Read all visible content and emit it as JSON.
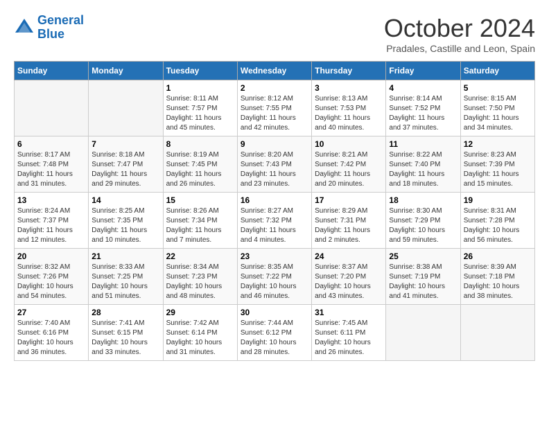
{
  "header": {
    "logo_line1": "General",
    "logo_line2": "Blue",
    "month_title": "October 2024",
    "location": "Pradales, Castille and Leon, Spain"
  },
  "weekdays": [
    "Sunday",
    "Monday",
    "Tuesday",
    "Wednesday",
    "Thursday",
    "Friday",
    "Saturday"
  ],
  "weeks": [
    [
      {
        "day": "",
        "info": ""
      },
      {
        "day": "",
        "info": ""
      },
      {
        "day": "1",
        "info": "Sunrise: 8:11 AM\nSunset: 7:57 PM\nDaylight: 11 hours and 45 minutes."
      },
      {
        "day": "2",
        "info": "Sunrise: 8:12 AM\nSunset: 7:55 PM\nDaylight: 11 hours and 42 minutes."
      },
      {
        "day": "3",
        "info": "Sunrise: 8:13 AM\nSunset: 7:53 PM\nDaylight: 11 hours and 40 minutes."
      },
      {
        "day": "4",
        "info": "Sunrise: 8:14 AM\nSunset: 7:52 PM\nDaylight: 11 hours and 37 minutes."
      },
      {
        "day": "5",
        "info": "Sunrise: 8:15 AM\nSunset: 7:50 PM\nDaylight: 11 hours and 34 minutes."
      }
    ],
    [
      {
        "day": "6",
        "info": "Sunrise: 8:17 AM\nSunset: 7:48 PM\nDaylight: 11 hours and 31 minutes."
      },
      {
        "day": "7",
        "info": "Sunrise: 8:18 AM\nSunset: 7:47 PM\nDaylight: 11 hours and 29 minutes."
      },
      {
        "day": "8",
        "info": "Sunrise: 8:19 AM\nSunset: 7:45 PM\nDaylight: 11 hours and 26 minutes."
      },
      {
        "day": "9",
        "info": "Sunrise: 8:20 AM\nSunset: 7:43 PM\nDaylight: 11 hours and 23 minutes."
      },
      {
        "day": "10",
        "info": "Sunrise: 8:21 AM\nSunset: 7:42 PM\nDaylight: 11 hours and 20 minutes."
      },
      {
        "day": "11",
        "info": "Sunrise: 8:22 AM\nSunset: 7:40 PM\nDaylight: 11 hours and 18 minutes."
      },
      {
        "day": "12",
        "info": "Sunrise: 8:23 AM\nSunset: 7:39 PM\nDaylight: 11 hours and 15 minutes."
      }
    ],
    [
      {
        "day": "13",
        "info": "Sunrise: 8:24 AM\nSunset: 7:37 PM\nDaylight: 11 hours and 12 minutes."
      },
      {
        "day": "14",
        "info": "Sunrise: 8:25 AM\nSunset: 7:35 PM\nDaylight: 11 hours and 10 minutes."
      },
      {
        "day": "15",
        "info": "Sunrise: 8:26 AM\nSunset: 7:34 PM\nDaylight: 11 hours and 7 minutes."
      },
      {
        "day": "16",
        "info": "Sunrise: 8:27 AM\nSunset: 7:32 PM\nDaylight: 11 hours and 4 minutes."
      },
      {
        "day": "17",
        "info": "Sunrise: 8:29 AM\nSunset: 7:31 PM\nDaylight: 11 hours and 2 minutes."
      },
      {
        "day": "18",
        "info": "Sunrise: 8:30 AM\nSunset: 7:29 PM\nDaylight: 10 hours and 59 minutes."
      },
      {
        "day": "19",
        "info": "Sunrise: 8:31 AM\nSunset: 7:28 PM\nDaylight: 10 hours and 56 minutes."
      }
    ],
    [
      {
        "day": "20",
        "info": "Sunrise: 8:32 AM\nSunset: 7:26 PM\nDaylight: 10 hours and 54 minutes."
      },
      {
        "day": "21",
        "info": "Sunrise: 8:33 AM\nSunset: 7:25 PM\nDaylight: 10 hours and 51 minutes."
      },
      {
        "day": "22",
        "info": "Sunrise: 8:34 AM\nSunset: 7:23 PM\nDaylight: 10 hours and 48 minutes."
      },
      {
        "day": "23",
        "info": "Sunrise: 8:35 AM\nSunset: 7:22 PM\nDaylight: 10 hours and 46 minutes."
      },
      {
        "day": "24",
        "info": "Sunrise: 8:37 AM\nSunset: 7:20 PM\nDaylight: 10 hours and 43 minutes."
      },
      {
        "day": "25",
        "info": "Sunrise: 8:38 AM\nSunset: 7:19 PM\nDaylight: 10 hours and 41 minutes."
      },
      {
        "day": "26",
        "info": "Sunrise: 8:39 AM\nSunset: 7:18 PM\nDaylight: 10 hours and 38 minutes."
      }
    ],
    [
      {
        "day": "27",
        "info": "Sunrise: 7:40 AM\nSunset: 6:16 PM\nDaylight: 10 hours and 36 minutes."
      },
      {
        "day": "28",
        "info": "Sunrise: 7:41 AM\nSunset: 6:15 PM\nDaylight: 10 hours and 33 minutes."
      },
      {
        "day": "29",
        "info": "Sunrise: 7:42 AM\nSunset: 6:14 PM\nDaylight: 10 hours and 31 minutes."
      },
      {
        "day": "30",
        "info": "Sunrise: 7:44 AM\nSunset: 6:12 PM\nDaylight: 10 hours and 28 minutes."
      },
      {
        "day": "31",
        "info": "Sunrise: 7:45 AM\nSunset: 6:11 PM\nDaylight: 10 hours and 26 minutes."
      },
      {
        "day": "",
        "info": ""
      },
      {
        "day": "",
        "info": ""
      }
    ]
  ]
}
